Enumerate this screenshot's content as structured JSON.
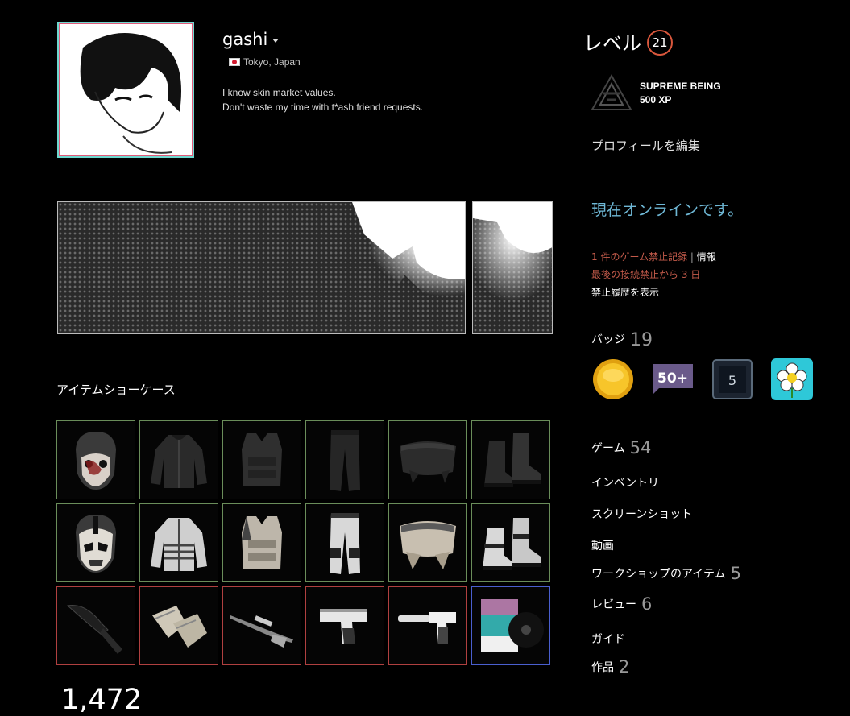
{
  "profile": {
    "persona_name": "gashi",
    "location": "Tokyo, Japan",
    "summary_line1": "I know skin market values.",
    "summary_line2": "Don't waste my time with t*ash friend requests."
  },
  "showcase": {
    "title": "アイテムショーケース",
    "count": "1,472",
    "items": [
      {
        "name": "skull-mask",
        "rarity": "green"
      },
      {
        "name": "dark-jacket",
        "rarity": "green"
      },
      {
        "name": "dark-vest",
        "rarity": "green"
      },
      {
        "name": "dark-pants",
        "rarity": "green"
      },
      {
        "name": "dark-kilt",
        "rarity": "green"
      },
      {
        "name": "dark-boots",
        "rarity": "green"
      },
      {
        "name": "white-mask",
        "rarity": "green"
      },
      {
        "name": "white-jacket",
        "rarity": "green"
      },
      {
        "name": "white-vest",
        "rarity": "green"
      },
      {
        "name": "white-pants",
        "rarity": "green"
      },
      {
        "name": "white-kilt",
        "rarity": "green"
      },
      {
        "name": "white-boots",
        "rarity": "green"
      },
      {
        "name": "kukri-knife",
        "rarity": "red"
      },
      {
        "name": "gloves",
        "rarity": "red"
      },
      {
        "name": "sniper-rifle",
        "rarity": "red"
      },
      {
        "name": "desert-eagle",
        "rarity": "red"
      },
      {
        "name": "silenced-pistol",
        "rarity": "red"
      },
      {
        "name": "music-kit",
        "rarity": "blue"
      }
    ]
  },
  "sidebar": {
    "level_label": "レベル",
    "level": "21",
    "xp_badge_name": "SUPREME BEING",
    "xp_value": "500 XP",
    "edit_profile": "プロフィールを編集",
    "online_status": "現在オンラインです。",
    "ban_line1": "1 件のゲーム禁止記録",
    "ban_sep": " | ",
    "ban_info": "情報",
    "ban_line2": "最後の接続禁止から 3 日",
    "ban_history": "禁止履歴を表示",
    "badges_label": "バッジ",
    "badges_count": "19",
    "badges": [
      {
        "icon": "gold-coin-icon"
      },
      {
        "icon": "fifty-plus-icon",
        "text": "50+"
      },
      {
        "icon": "years-service-icon",
        "text": "5"
      },
      {
        "icon": "flower-icon"
      }
    ],
    "games_label": "ゲーム",
    "games_count": "54",
    "inventory_label": "インベントリ",
    "screenshots_label": "スクリーンショット",
    "videos_label": "動画",
    "workshop_label": "ワークショップのアイテム",
    "workshop_count": "5",
    "reviews_label": "レビュー",
    "reviews_count": "6",
    "guides_label": "ガイド",
    "artwork_label": "作品",
    "artwork_count": "2"
  },
  "colors": {
    "online": "#6fb8d6",
    "ban": "#c25a4a",
    "level_ring": "#d9573c",
    "rarity_green": "#6a8d5a",
    "rarity_red": "#b04040",
    "rarity_blue": "#4a5fcf"
  }
}
